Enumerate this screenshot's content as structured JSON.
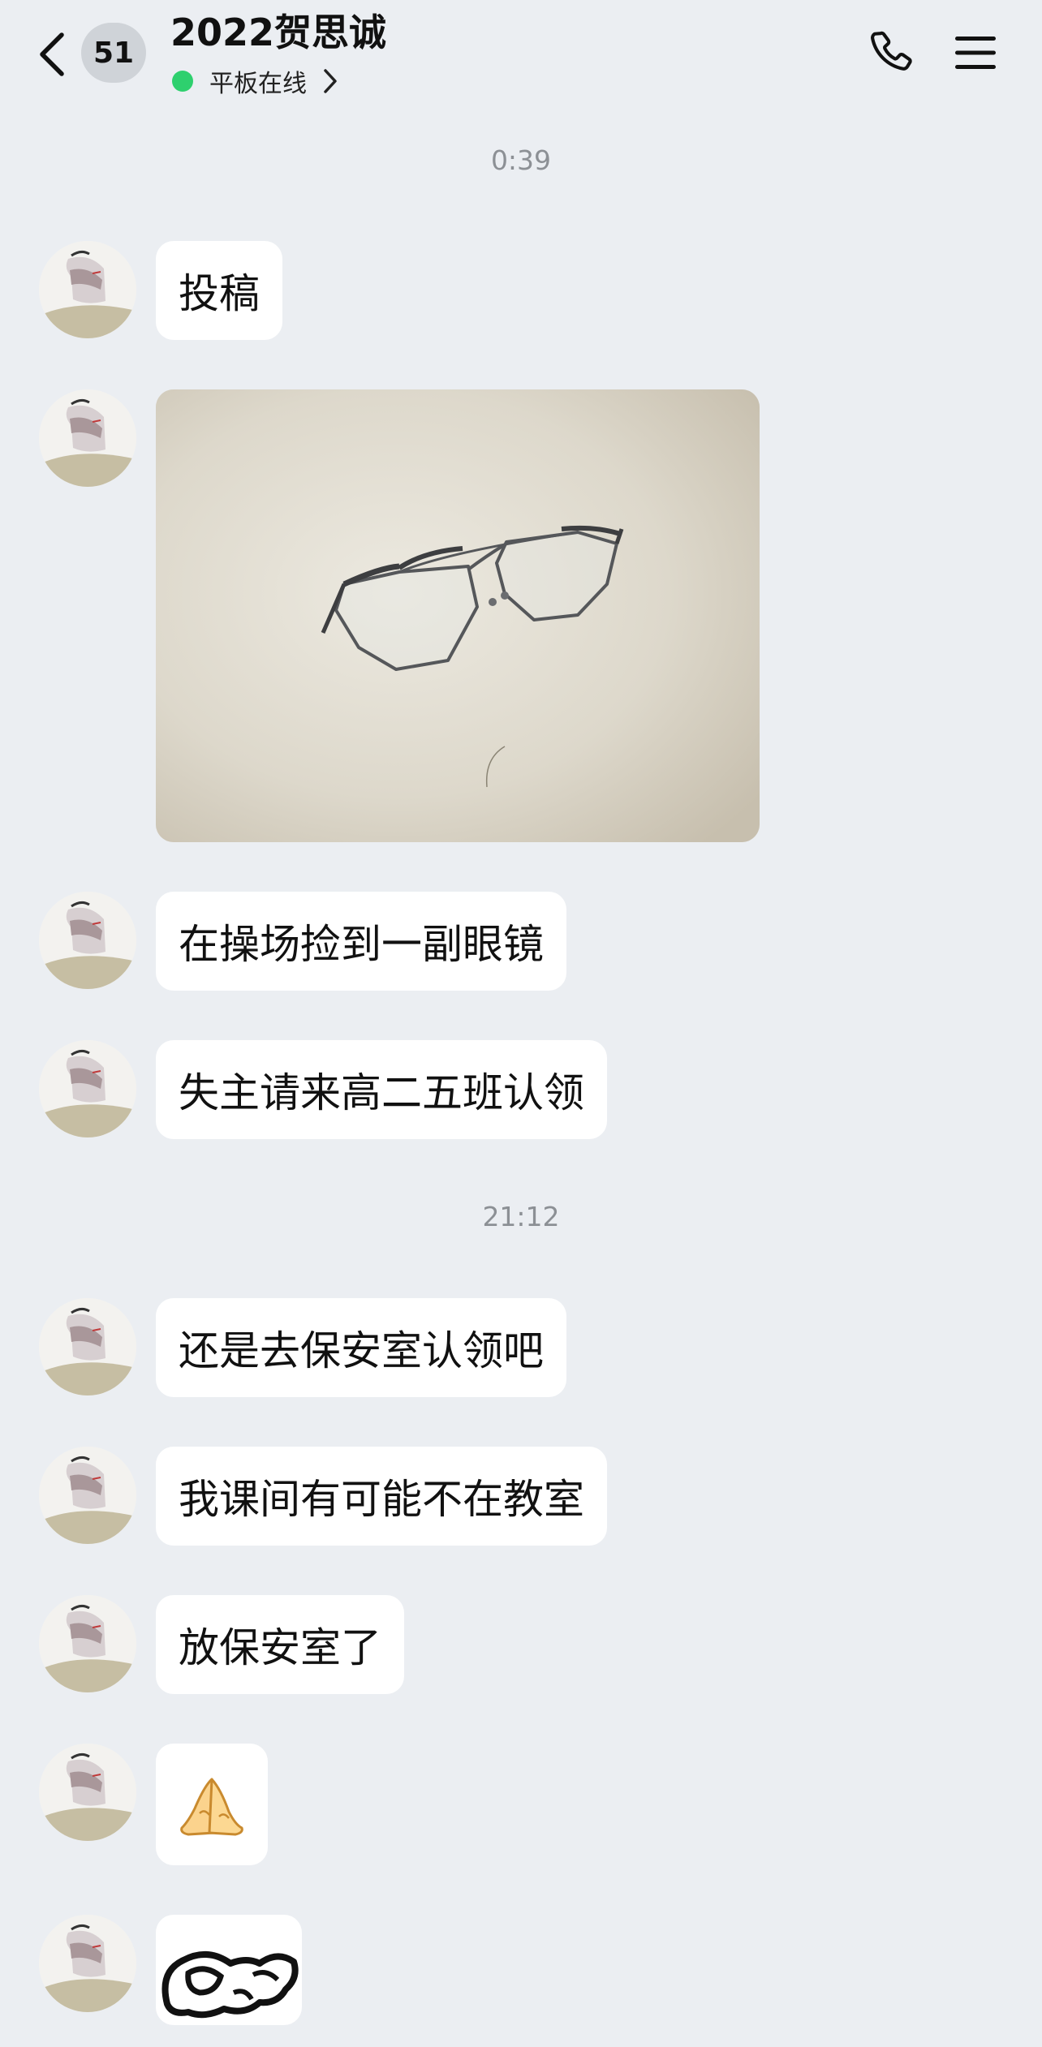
{
  "header": {
    "unread_count": "51",
    "title": "2022贺思诚",
    "status": "平板在线",
    "status_color": "#2ed06e"
  },
  "icons": {
    "back": "back-chevron-icon",
    "call": "phone-icon",
    "menu": "hamburger-menu-icon",
    "status_more": "chevron-right-icon"
  },
  "chat": {
    "time_1": "0:39",
    "time_2": "21:12",
    "messages": [
      {
        "type": "text",
        "text": "投稿"
      },
      {
        "type": "image",
        "subject": "glasses photo"
      },
      {
        "type": "text",
        "text": "在操场捡到一副眼镜"
      },
      {
        "type": "text",
        "text": "失主请来高二五班认领"
      },
      {
        "type": "text",
        "text": "还是去保安室认领吧"
      },
      {
        "type": "text",
        "text": "我课间有可能不在教室"
      },
      {
        "type": "text",
        "text": "放保安室了"
      },
      {
        "type": "sticker",
        "emoji": "🙏"
      },
      {
        "type": "sticker",
        "subject": "sketch sticker"
      }
    ]
  },
  "colors": {
    "background": "#ebeef2",
    "bubble": "#ffffff",
    "timestamp": "#8c9095"
  }
}
